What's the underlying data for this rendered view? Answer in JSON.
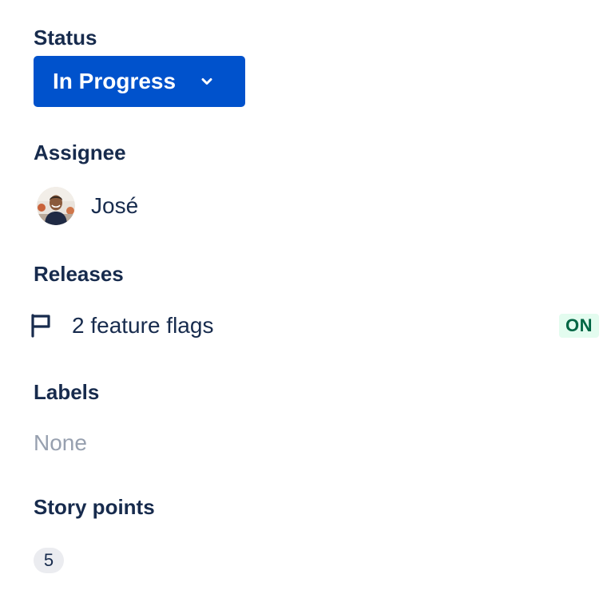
{
  "status": {
    "label": "Status",
    "value": "In Progress",
    "button_color": "#0052CC",
    "dropdown_icon": "chevron-down-icon"
  },
  "assignee": {
    "label": "Assignee",
    "name": "José",
    "avatar_icon": "user-avatar"
  },
  "releases": {
    "label": "Releases",
    "icon": "flag-icon",
    "text": "2 feature flags",
    "badge": "ON",
    "badge_bg": "#E3FCEF",
    "badge_color": "#006644"
  },
  "labels": {
    "label": "Labels",
    "value": "None"
  },
  "story_points": {
    "label": "Story points",
    "value": "5"
  }
}
